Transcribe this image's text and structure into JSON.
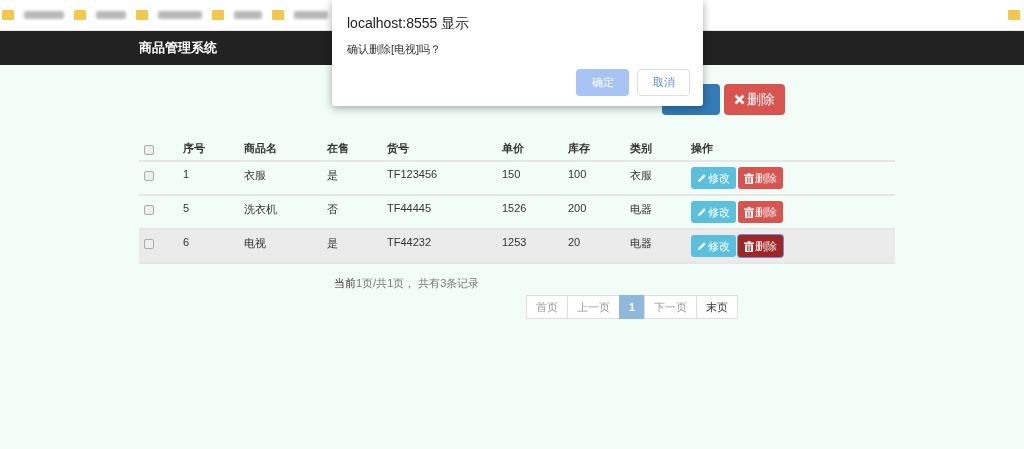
{
  "navbar": {
    "brand": "商品管理系统"
  },
  "toolbar": {
    "buttons": [
      {
        "kind": "add"
      },
      {
        "kind": "delete",
        "label": "删除"
      }
    ]
  },
  "table": {
    "columns": [
      "序号",
      "商品名",
      "在售",
      "货号",
      "单价",
      "库存",
      "类别",
      "操作"
    ],
    "header_checked": false,
    "rows": [
      {
        "checked": false,
        "highlighted": false,
        "cells": [
          "1",
          "衣服",
          "是",
          "TF123456",
          "150",
          "100",
          "衣服"
        ],
        "edit": "修改",
        "delete": "删除",
        "delete_active": false
      },
      {
        "checked": false,
        "highlighted": false,
        "cells": [
          "5",
          "洗衣机",
          "否",
          "TF44445",
          "1526",
          "200",
          "电器"
        ],
        "edit": "修改",
        "delete": "删除",
        "delete_active": false
      },
      {
        "checked": false,
        "highlighted": true,
        "cells": [
          "6",
          "电视",
          "是",
          "TF44232",
          "1253",
          "20",
          "电器"
        ],
        "edit": "修改",
        "delete": "删除",
        "delete_active": true
      }
    ]
  },
  "pager": {
    "info": "**当前**1页/共1页，  共有3条记录",
    "pages": [
      {
        "label": "首页",
        "disabled": true,
        "selected": false
      },
      {
        "label": "上一页",
        "disabled": true,
        "selected": false
      },
      {
        "label": "1",
        "disabled": false,
        "selected": true
      },
      {
        "label": "下一页",
        "disabled": true,
        "selected": false
      },
      {
        "label": "末页",
        "disabled": false,
        "selected": false
      }
    ]
  },
  "dialog": {
    "title": "localhost:8555 显示",
    "message": "确认删除[电视]吗？",
    "buttons": [
      {
        "label": "确定",
        "primary": true
      },
      {
        "label": "取消",
        "primary": false
      }
    ]
  }
}
